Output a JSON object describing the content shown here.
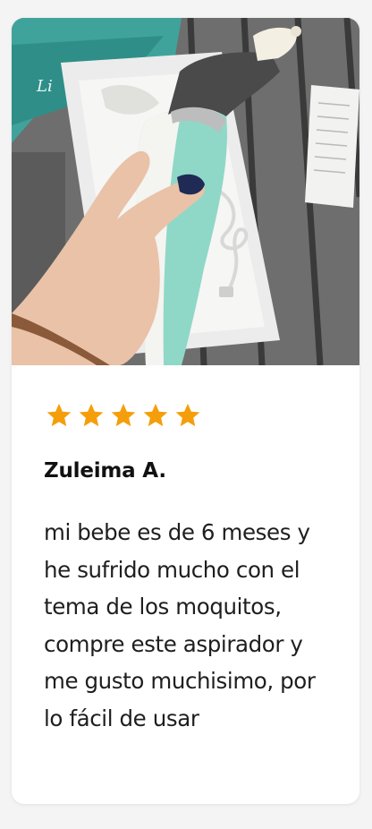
{
  "review": {
    "rating": 5,
    "max_rating": 5,
    "star_color": "#f59e0b",
    "author": "Zuleima A.",
    "text": "mi bebe es de 6 meses y he sufrido mucho con el tema de los moquitos, compre este aspirador y me gusto muchisimo, por lo fácil de usar",
    "photo": {
      "icon": "product-photo",
      "box_label": "Li"
    }
  }
}
